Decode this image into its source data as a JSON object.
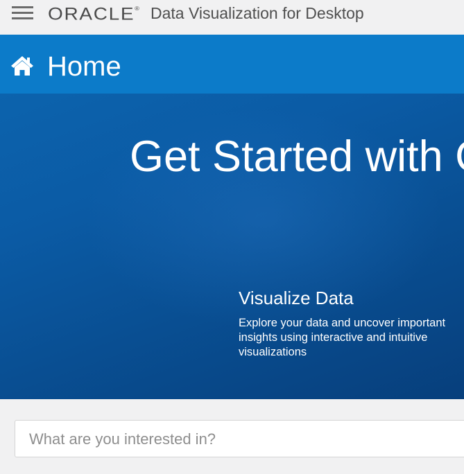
{
  "topbar": {
    "menu_icon": "hamburger-menu-icon",
    "logo_text": "ORACLE",
    "logo_mark": "®",
    "app_title": "Data Visualization for Desktop"
  },
  "homebar": {
    "icon": "home-icon",
    "title": "Home"
  },
  "hero": {
    "title": "Get Started with Oracle",
    "feature": {
      "title": "Visualize Data",
      "description": "Explore your data and uncover important insights using interactive and intuitive visualizations"
    }
  },
  "search": {
    "placeholder": "What are you interested in?",
    "value": ""
  },
  "colors": {
    "topbar_bg": "#f1f1f2",
    "homebar_bg": "#0c7bc9",
    "hero_bg": "#0a559c",
    "text_light": "#ffffff"
  }
}
